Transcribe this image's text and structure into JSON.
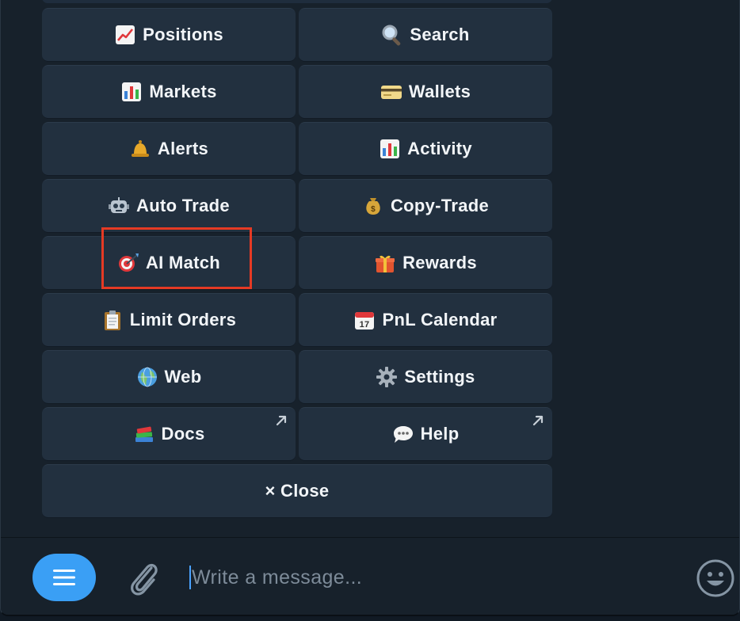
{
  "keyboard": {
    "rows": [
      [
        {
          "label": "Positions",
          "icon": "chart-increasing-icon"
        },
        {
          "label": "Search",
          "icon": "magnifying-glass-icon"
        }
      ],
      [
        {
          "label": "Markets",
          "icon": "bar-chart-icon"
        },
        {
          "label": "Wallets",
          "icon": "credit-card-icon"
        }
      ],
      [
        {
          "label": "Alerts",
          "icon": "bell-icon"
        },
        {
          "label": "Activity",
          "icon": "bar-chart-icon"
        }
      ],
      [
        {
          "label": "Auto Trade",
          "icon": "robot-icon"
        },
        {
          "label": "Copy-Trade",
          "icon": "money-bag-icon"
        }
      ],
      [
        {
          "label": "AI Match",
          "icon": "direct-hit-icon"
        },
        {
          "label": "Rewards",
          "icon": "gift-icon"
        }
      ],
      [
        {
          "label": "Limit Orders",
          "icon": "clipboard-icon"
        },
        {
          "label": "PnL Calendar",
          "icon": "calendar-icon"
        }
      ],
      [
        {
          "label": "Web",
          "icon": "globe-icon"
        },
        {
          "label": "Settings",
          "icon": "gear-icon"
        }
      ],
      [
        {
          "label": "Docs",
          "icon": "books-icon",
          "external": true
        },
        {
          "label": "Help",
          "icon": "speech-bubble-icon",
          "external": true
        }
      ]
    ],
    "close": {
      "label": "× Close"
    }
  },
  "highlighted_button": "AI Match",
  "composer": {
    "placeholder": "Write a message..."
  },
  "colors": {
    "background": "#17212b",
    "button": "#22303f",
    "accent": "#3a9ff5",
    "highlight": "#e53a24"
  }
}
